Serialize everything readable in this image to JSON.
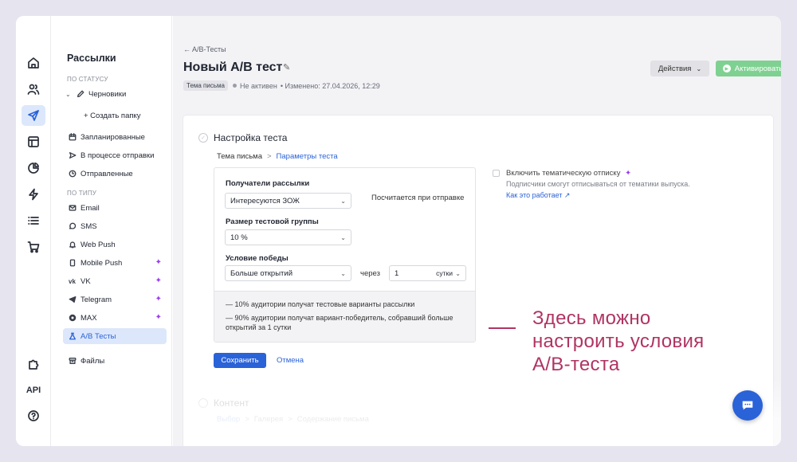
{
  "colors": {
    "accent": "#2a62d8",
    "activate": "#7fd191",
    "callout": "#b03463",
    "spark": "#9b3ef0"
  },
  "rail": {
    "items": [
      "home-icon",
      "users-icon",
      "send-icon",
      "layout-icon",
      "pie-chart-icon",
      "lightning-icon",
      "list-icon",
      "cart-icon",
      "puzzle-icon"
    ],
    "api_label": "API",
    "help_icon": "help-icon"
  },
  "sidebar": {
    "title": "Рассылки",
    "by_status": "ПО СТАТУСУ",
    "drafts": "Черновики",
    "create_folder": "+ Создать папку",
    "scheduled": "Запланированные",
    "sending": "В процессе отправки",
    "sent": "Отправленные",
    "by_type": "ПО ТИПУ",
    "email": "Email",
    "sms": "SMS",
    "web_push": "Web Push",
    "mobile_push": "Mobile Push",
    "vk": "VK",
    "telegram": "Telegram",
    "max": "MAX",
    "ab_tests": "A/B Тесты",
    "files": "Файлы"
  },
  "header": {
    "breadcrumb": "← A/B-Тесты",
    "title": "Новый A/B тест",
    "tag": "Тема письма",
    "status": "Не активен",
    "changed": "• Изменено: 27.04.2026, 12:29",
    "actions_label": "Действия",
    "activate_label": "Активировать"
  },
  "step1": {
    "title": "Настройка теста",
    "tab_subject": "Тема письма",
    "tab_sep": ">",
    "tab_params": "Параметры теста",
    "recipients_label": "Получатели рассылки",
    "recipients_value": "Интересуются ЗОЖ",
    "recipients_note": "Посчитается при отправке",
    "group_size_label": "Размер тестовой группы",
    "group_size_value": "10 %",
    "win_condition_label": "Условие победы",
    "win_condition_value": "Больше открытий",
    "after_label": "через",
    "after_value": "1",
    "after_unit": "сутки",
    "summary_1": "— 10% аудитории получат тестовые варианты рассылки",
    "summary_2": "— 90% аудитории получат вариант-победитель, собравший больше открытий за 1 сутки",
    "optin_label": "Включить тематическую отписку",
    "optin_sub": "Подписчики смогут отписываться от тематики выпуска.",
    "optin_link": "Как это работает ↗",
    "save_label": "Сохранить",
    "cancel_label": "Отмена"
  },
  "step2": {
    "title": "Контент",
    "tab_choice": "Выбор",
    "tab_gallery": "Галерея",
    "tab_content": "Содержание письма",
    "sep": ">"
  },
  "callout": {
    "line1": "Здесь можно",
    "line2": "настроить условия",
    "line3": "А/В-теста"
  }
}
